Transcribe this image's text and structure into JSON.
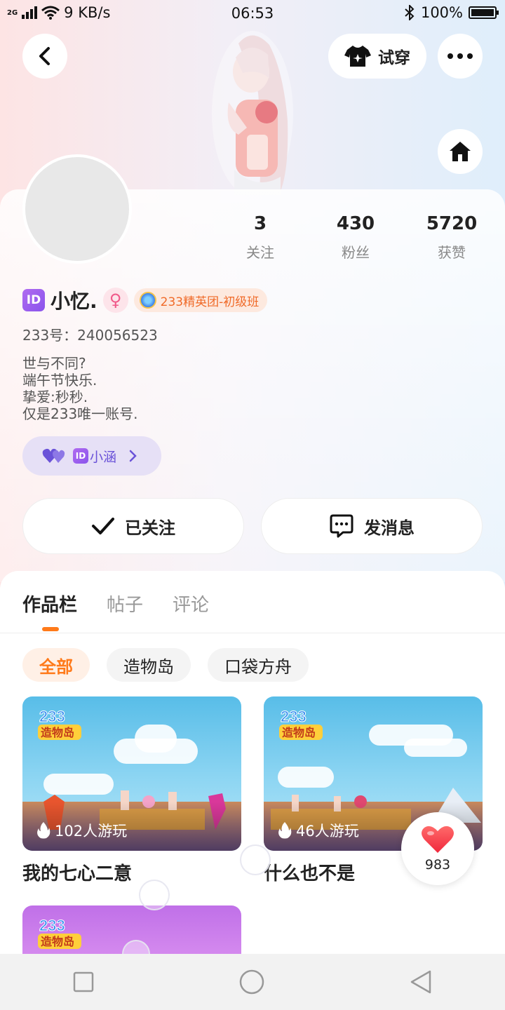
{
  "status_bar": {
    "network": "2G",
    "speed": "9 KB/s",
    "time": "06:53",
    "battery": "100%"
  },
  "header": {
    "back_icon": "chevron-left-icon",
    "tryon_label": "试穿",
    "tryon_icon": "shirt-icon",
    "more_icon": "more-dots-icon",
    "home_icon": "home-icon"
  },
  "profile": {
    "stats": [
      {
        "value": "3",
        "label": "关注"
      },
      {
        "value": "430",
        "label": "粉丝"
      },
      {
        "value": "5720",
        "label": "获赞"
      }
    ],
    "id_badge": "ID",
    "name": "小忆.",
    "gender_symbol": "♀",
    "rank_badge": "233精英团-初级班",
    "uid": "233号：240056523",
    "bio": [
      "世与不同?",
      "端午节快乐.",
      "挚爱:秒秒.",
      "仅是233唯一账号."
    ],
    "cp_id_badge": "ID",
    "cp_name": "小涵"
  },
  "actions": {
    "follow_label": "已关注",
    "message_label": "发消息"
  },
  "tabs": [
    "作品栏",
    "帖子",
    "评论"
  ],
  "filters": [
    "全部",
    "造物岛",
    "口袋方舟"
  ],
  "works": [
    {
      "title": "我的七心二意",
      "plays": "102人游玩",
      "logo_top": "233",
      "logo_bottom": "造物岛"
    },
    {
      "title": "什么也不是",
      "plays": "46人游玩",
      "logo_top": "233",
      "logo_bottom": "造物岛"
    },
    {
      "title": "",
      "plays": "",
      "logo_top": "233",
      "logo_bottom": "造物岛"
    }
  ],
  "like": {
    "count": "983"
  },
  "colors": {
    "accent": "#ff7a1a",
    "purple": "#6a52d8"
  }
}
